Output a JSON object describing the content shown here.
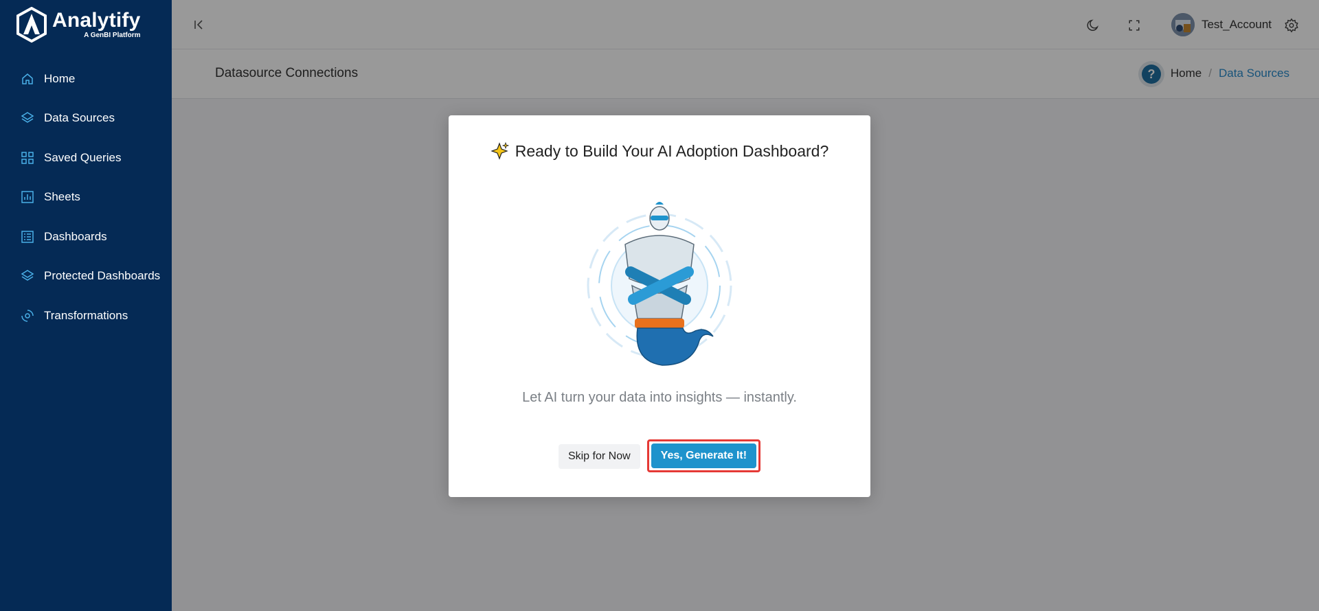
{
  "brand": {
    "name": "Analytify",
    "tagline": "A GenBI Platform"
  },
  "sidebar": {
    "items": [
      {
        "label": "Home",
        "icon": "home-icon"
      },
      {
        "label": "Data Sources",
        "icon": "layers-icon"
      },
      {
        "label": "Saved Queries",
        "icon": "grid-icon"
      },
      {
        "label": "Sheets",
        "icon": "bar-chart-icon"
      },
      {
        "label": "Dashboards",
        "icon": "list-icon"
      },
      {
        "label": "Protected Dashboards",
        "icon": "layers-icon"
      },
      {
        "label": "Transformations",
        "icon": "transform-icon"
      }
    ]
  },
  "topbar": {
    "account_name": "Test_Account"
  },
  "page": {
    "title": "Datasource Connections"
  },
  "breadcrumb": {
    "home": "Home",
    "separator": "/",
    "current": "Data Sources"
  },
  "help": {
    "label": "?"
  },
  "modal": {
    "title": "Ready to Build Your AI Adoption Dashboard?",
    "subtitle": "Let AI turn your data into insights — instantly.",
    "skip_label": "Skip for Now",
    "confirm_label": "Yes, Generate It!"
  },
  "colors": {
    "sidebar_bg": "#052a55",
    "accent": "#1e93cc",
    "icon_accent": "#4ab0e8",
    "highlight": "#e53935"
  }
}
